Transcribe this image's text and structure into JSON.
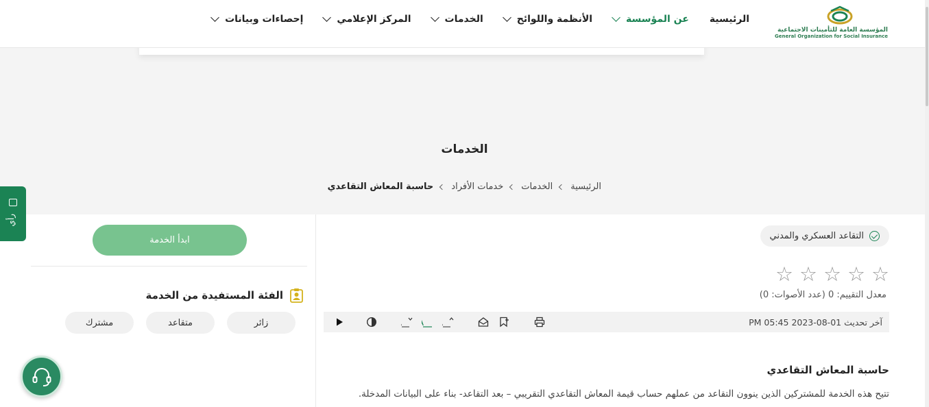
{
  "logo": {
    "arabic": "المؤسسة العامة للتأمينات الاجتماعية",
    "english": "General Organization for Social Insurance"
  },
  "nav": {
    "items": [
      {
        "label": "الرئيسية",
        "has_dropdown": false,
        "active": false
      },
      {
        "label": "عن المؤسسة",
        "has_dropdown": true,
        "active": true
      },
      {
        "label": "الأنظمة واللوائح",
        "has_dropdown": true,
        "active": false
      },
      {
        "label": "الخدمات",
        "has_dropdown": true,
        "active": false
      },
      {
        "label": "المركز الإعلامي",
        "has_dropdown": true,
        "active": false
      },
      {
        "label": "إحصاءات وبيانات",
        "has_dropdown": true,
        "active": false
      }
    ]
  },
  "hero": {
    "title": "الخدمات"
  },
  "breadcrumb": {
    "items": [
      "الرئيسية",
      "الخدمات",
      "خدمات الأفراد"
    ],
    "current": "حاسبة المعاش التقاعدي"
  },
  "feedback": {
    "label": "رأي",
    "icon": "feedback-icon"
  },
  "service": {
    "tag": "التقاعد العسكري والمدني",
    "rating_stars": 5,
    "rating_value": 0,
    "rating_text": "معدل التقييم: 0 (عدد الأصوات: 0)",
    "last_updated": "آخر تحديث 01-08-2023 05:45 PM",
    "tools": [
      "print-icon",
      "bookmark-icon",
      "email-icon",
      "increase-font-icon",
      "font-icon",
      "decrease-font-icon",
      "contrast-icon",
      "play-icon"
    ],
    "section_title": "حاسبة المعاش التقاعدي",
    "description": "تتيح هذه الخدمة للمشتركين الذين ينوون التقاعد من عملهم حساب قيمة المعاش التقاعدي التقريبي – بعد التقاعد- بناء على البيانات المدخلة."
  },
  "sidebar": {
    "start_button": "ابدأ الخدمة",
    "beneficiary_title": "الفئة المستفيدة من الخدمة",
    "chips": [
      "زائر",
      "متقاعد",
      "مشترك"
    ]
  },
  "colors": {
    "brand_green": "#1b8354",
    "button_green": "#78c38f",
    "fab_green": "#2a8a62"
  }
}
